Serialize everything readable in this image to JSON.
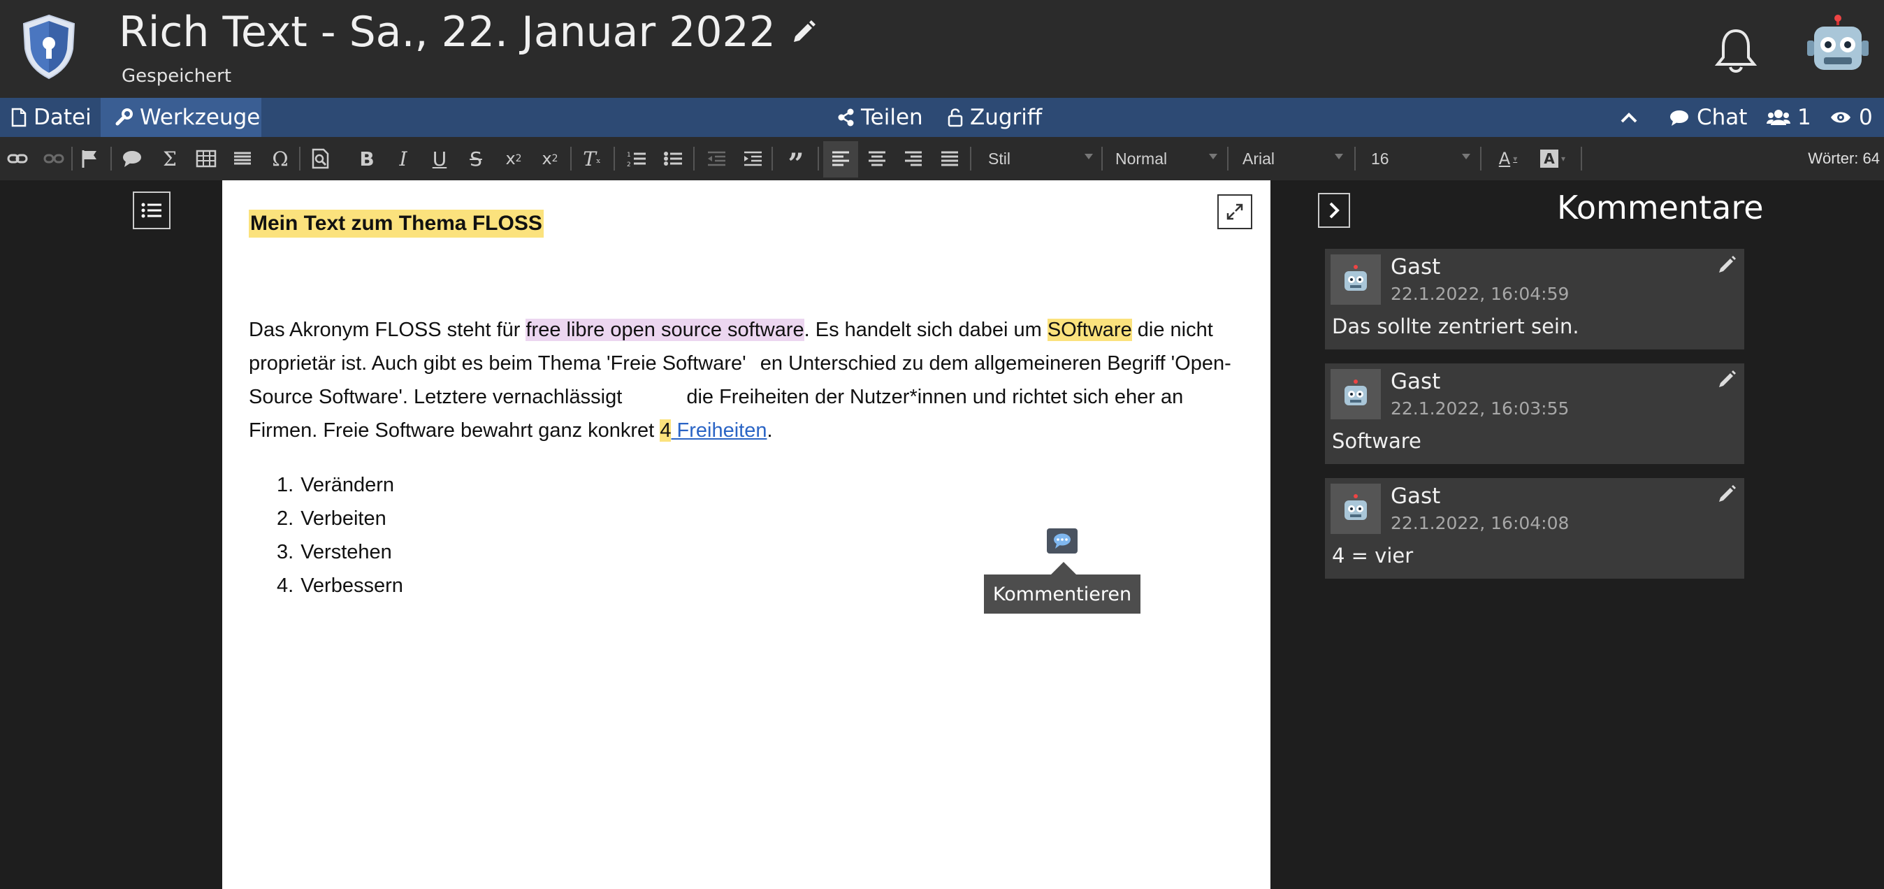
{
  "header": {
    "title": "Rich Text - Sa., 22. Januar 2022",
    "status": "Gespeichert",
    "logo_icon": "shield-keyhole-icon",
    "bell_icon": "bell-icon",
    "user_avatar_icon": "robot-avatar-icon"
  },
  "menubar": {
    "file": "Datei",
    "tools": "Werkzeuge",
    "share": "Teilen",
    "access": "Zugriff",
    "chat": "Chat",
    "users_count": "1",
    "viewers_count": "0"
  },
  "toolbar": {
    "style": "Stil",
    "format": "Normal",
    "font": "Arial",
    "size": "16",
    "word_count": "Wörter: 64",
    "icons": [
      "link-icon",
      "unlink-icon",
      "flag-icon",
      "comment-icon",
      "sigma-icon",
      "table-icon",
      "horizontal-rule-icon",
      "omega-icon",
      "preview-icon",
      "bold-icon",
      "italic-icon",
      "underline-icon",
      "strikethrough-icon",
      "subscript-icon",
      "superscript-icon",
      "remove-format-icon",
      "ordered-list-icon",
      "bullet-list-icon",
      "outdent-icon",
      "indent-icon",
      "blockquote-icon",
      "align-left-icon",
      "align-center-icon",
      "align-right-icon",
      "align-justify-icon",
      "text-color-icon",
      "background-color-icon"
    ]
  },
  "document": {
    "heading": "Mein Text zum Thema FLOSS",
    "p_1": "Das Akronym FLOSS steht für ",
    "p_hl1": "free libre open source software",
    "p_2": ". Es handelt sich dabei um ",
    "p_hl2": "SOftware",
    "p_3": " die nicht proprietär ist. Auch gibt es beim Thema 'Freie Software' ",
    "p_4": "en Unterschied zu dem allgemeineren Begriff 'Open-Source Software'. Letztere vernachlässigt ",
    "p_5": "die Freiheiten der Nutzer*innen und richtet sich eher an Firmen. Freie Software bewahrt ganz konkret ",
    "p_hl3": "4",
    "p_link": " Freiheiten",
    "p_6": ".",
    "list": [
      {
        "num": "1.",
        "text": "Verändern"
      },
      {
        "num": "2.",
        "text": "Verbeiten"
      },
      {
        "num": "3.",
        "text": "Verstehen"
      },
      {
        "num": "4.",
        "text": "Verbessern"
      }
    ],
    "tooltip": "Kommentieren"
  },
  "comments": {
    "title": "Kommentare",
    "items": [
      {
        "author": "Gast",
        "time": "22.1.2022, 16:04:59",
        "text": "Das sollte zentriert sein."
      },
      {
        "author": "Gast",
        "time": "22.1.2022, 16:03:55",
        "text": "Software"
      },
      {
        "author": "Gast",
        "time": "22.1.2022, 16:04:08",
        "text": "4 = vier"
      }
    ]
  },
  "colors": {
    "menubar": "#2d4a74",
    "highlight_yellow": "#fbe27d",
    "highlight_pink": "#ecd6f0",
    "link": "#2a64c5"
  }
}
